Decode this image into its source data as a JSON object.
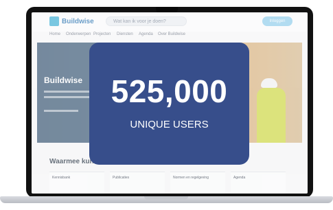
{
  "site": {
    "brand": "Buildwise",
    "search_placeholder": "Wat kan ik voor je doen?",
    "cta_label": "Inloggen",
    "nav": [
      "Home",
      "Onderwerpen",
      "Projecten",
      "Diensten",
      "Agenda",
      "Over Buildwise"
    ],
    "hero_title": "Buildwise",
    "help_title": "Waarmee kunnen we je helpen?",
    "cards": [
      "Kennisbank",
      "Publicaties",
      "Normen en regelgeving",
      "Agenda"
    ]
  },
  "stat": {
    "number": "525,000",
    "label": "UNIQUE USERS",
    "color": "#374e8b"
  }
}
